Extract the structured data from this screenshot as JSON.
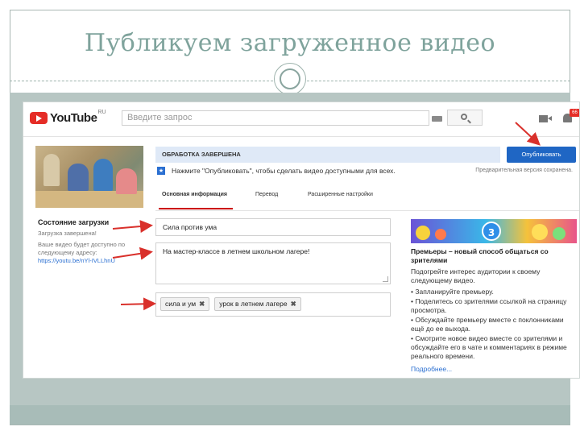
{
  "slide": {
    "title": "Публикуем загруженное видео"
  },
  "youtube": {
    "logo_text": "YouTube",
    "logo_region": "RU",
    "search_placeholder": "Введите запрос",
    "notification_count": "66"
  },
  "status": {
    "heading": "Состояние загрузки",
    "upload_done": "Загрузка завершена!",
    "available_text": "Ваше видео будет доступно по следующему адресу:",
    "video_link": "https://youtu.be/nYl-IVLLhnU"
  },
  "processing": {
    "banner": "ОБРАБОТКА ЗАВЕРШЕНА",
    "publish_button": "Опубликовать",
    "info_text": "Нажмите \"Опубликовать\", чтобы сделать видео доступными для всех.",
    "preview_saved": "Предварительная версия сохранена."
  },
  "tabs": [
    {
      "label": "Основная информация",
      "active": true
    },
    {
      "label": "Перевод",
      "active": false
    },
    {
      "label": "Расширенные настройки",
      "active": false
    }
  ],
  "form": {
    "title_value": "Сила против ума",
    "description_value": "На мастер-классе в летнем школьном лагере!",
    "tags": [
      "сила и ум",
      "урок в летнем лагере"
    ]
  },
  "promo": {
    "badge_number": "3",
    "heading": "Премьеры – новый способ общаться со зрителями",
    "intro": "Подогрейте интерес аудитории к своему следующему видео.",
    "bullets": [
      "• Запланируйте премьеру.",
      "• Поделитесь со зрителями ссылкой на страницу просмотра.",
      "• Обсуждайте премьеру вместе с поклонниками ещё до ее выхода.",
      "• Смотрите новое видео вместе со зрителями и обсуждайте его в чате и комментариях в режиме реального времени."
    ],
    "more_link": "Подробнее..."
  },
  "colors": {
    "youtube_red": "#e52d27",
    "publish_blue": "#1f66c4",
    "arrow_red": "#d9302b",
    "slide_teal": "#7fa39c"
  }
}
